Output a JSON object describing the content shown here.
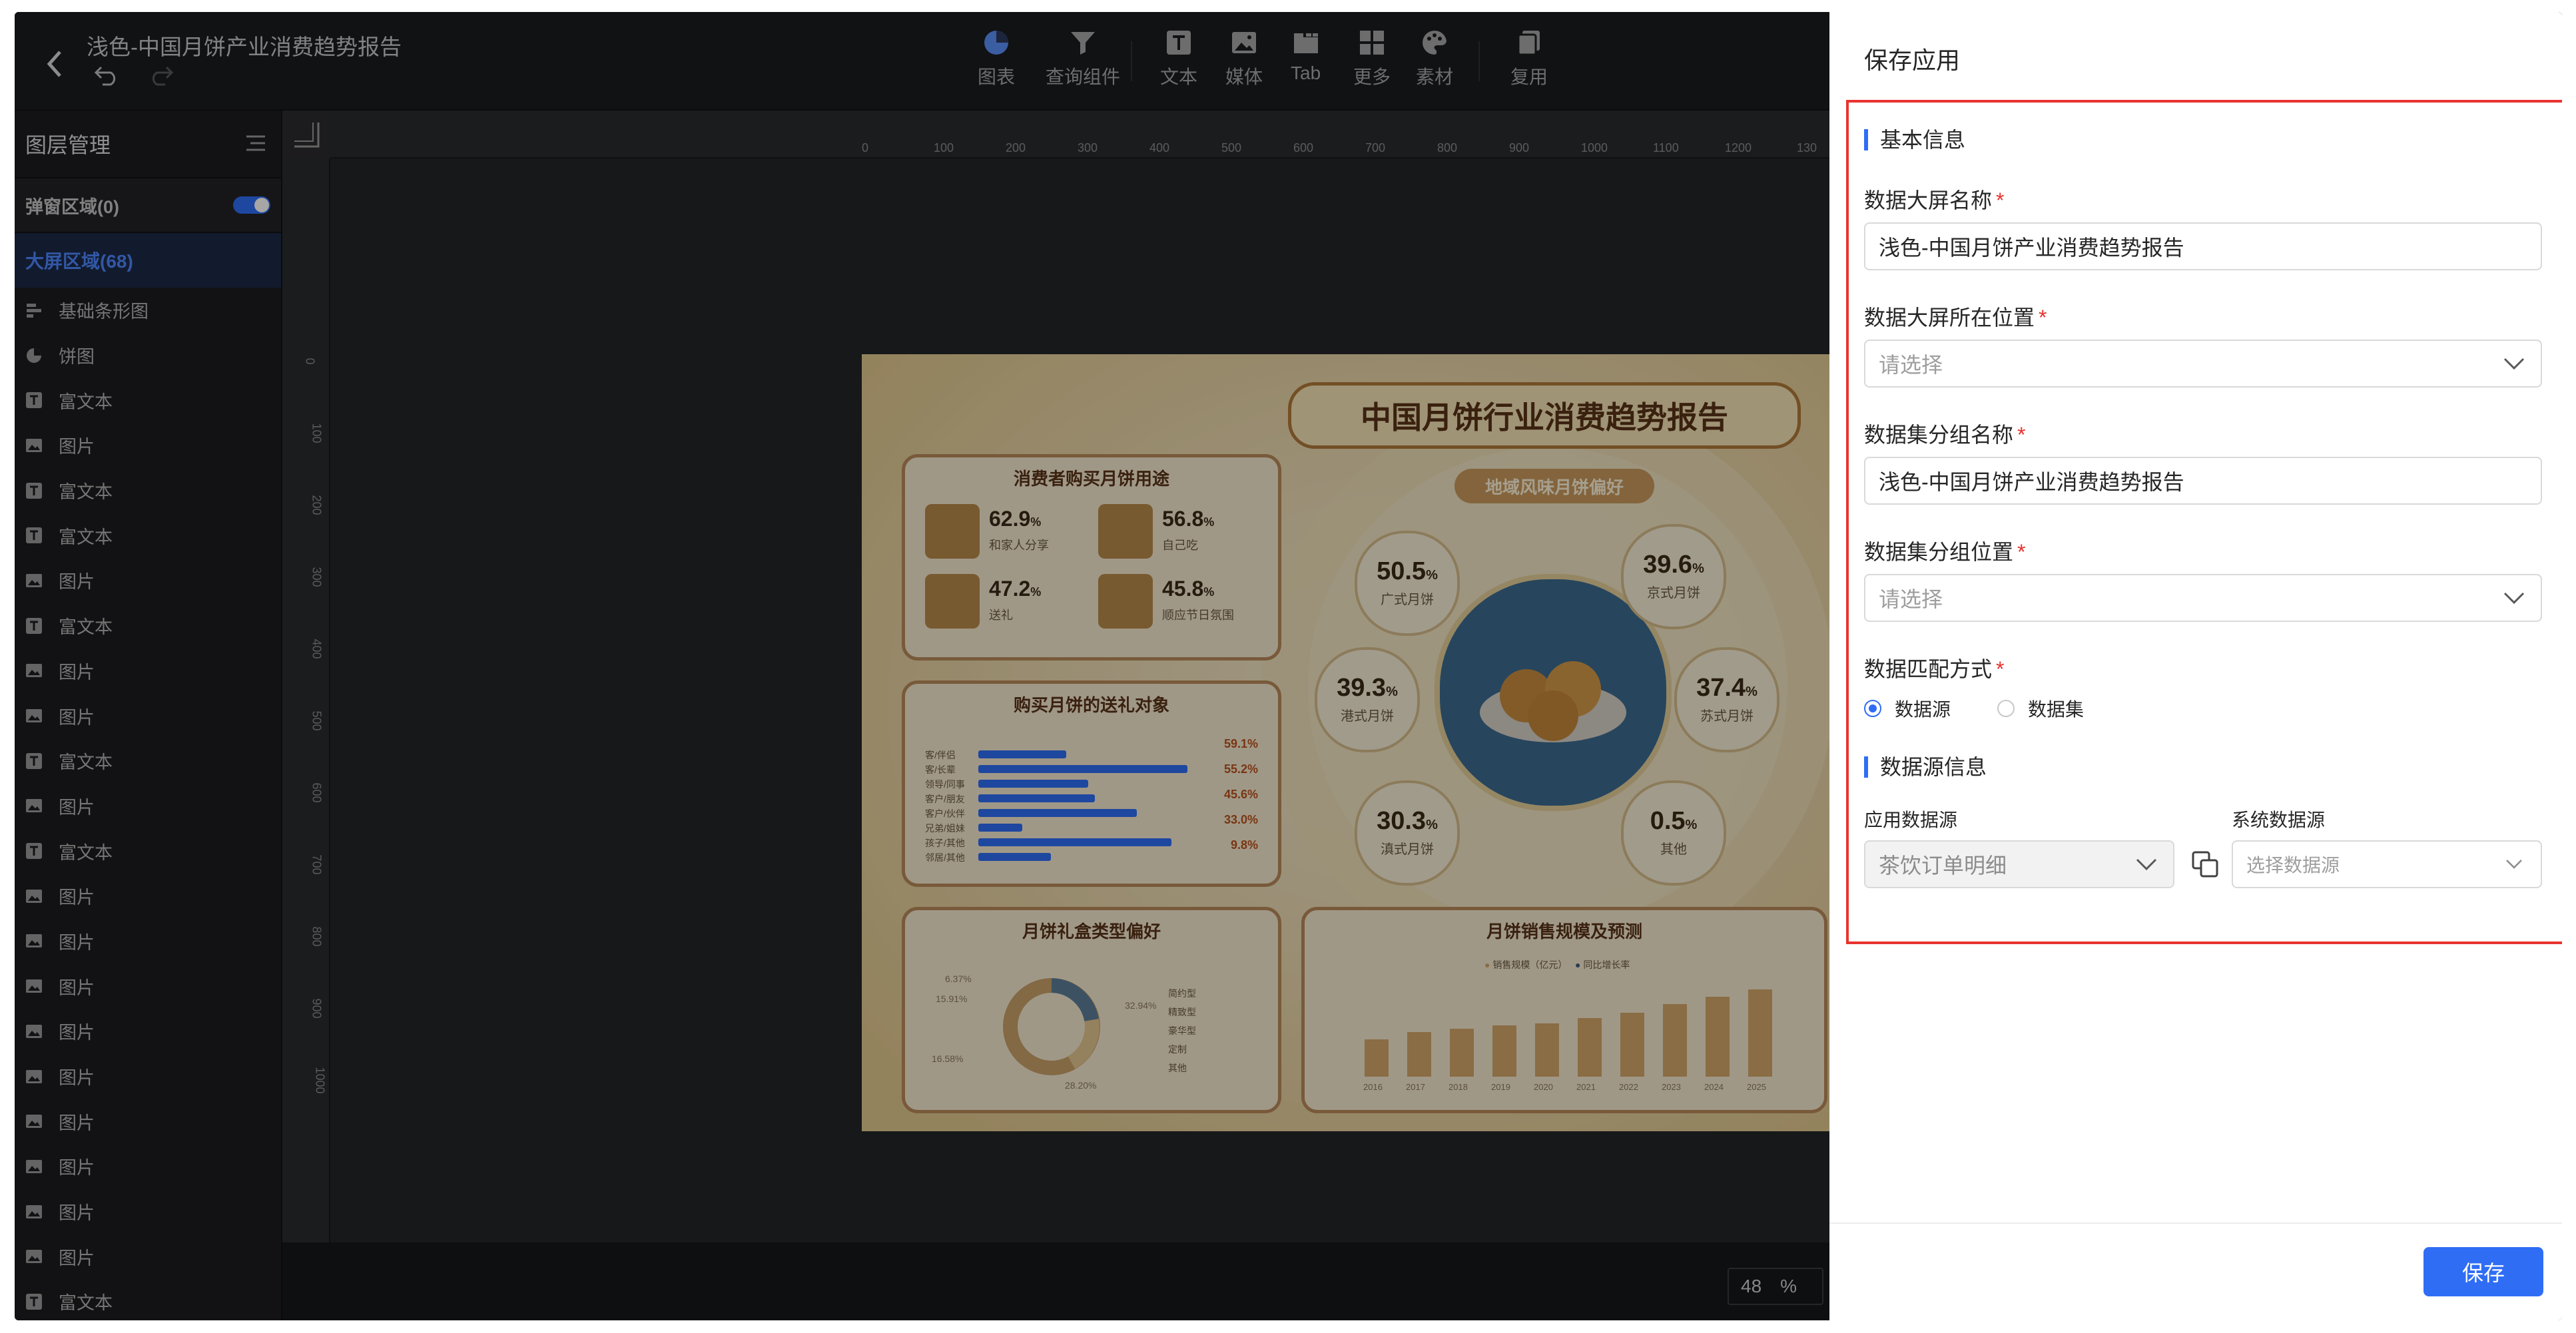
{
  "window": {
    "title": "浅色-中国月饼产业消费趋势报告"
  },
  "toolbar": {
    "items": [
      {
        "label": "图表",
        "icon": "pie-chart-icon",
        "active": true
      },
      {
        "label": "查询组件",
        "icon": "filter-icon"
      },
      {
        "label": "文本",
        "icon": "text-icon"
      },
      {
        "label": "媒体",
        "icon": "image-icon"
      },
      {
        "label": "Tab",
        "icon": "tab-icon"
      },
      {
        "label": "更多",
        "icon": "grid-icon"
      },
      {
        "label": "素材",
        "icon": "palette-icon"
      },
      {
        "label": "复用",
        "icon": "copy-icon"
      }
    ]
  },
  "sidebar": {
    "title": "图层管理",
    "popup_area": "弹窗区域(0)",
    "screen_area": "大屏区域(68)",
    "layers": [
      {
        "label": "基础条形图",
        "type": "bar"
      },
      {
        "label": "饼图",
        "type": "pie"
      },
      {
        "label": "富文本",
        "type": "text"
      },
      {
        "label": "图片",
        "type": "image"
      },
      {
        "label": "富文本",
        "type": "text"
      },
      {
        "label": "富文本",
        "type": "text"
      },
      {
        "label": "图片",
        "type": "image"
      },
      {
        "label": "富文本",
        "type": "text"
      },
      {
        "label": "图片",
        "type": "image"
      },
      {
        "label": "图片",
        "type": "image"
      },
      {
        "label": "富文本",
        "type": "text"
      },
      {
        "label": "图片",
        "type": "image"
      },
      {
        "label": "富文本",
        "type": "text"
      },
      {
        "label": "图片",
        "type": "image"
      },
      {
        "label": "图片",
        "type": "image"
      },
      {
        "label": "图片",
        "type": "image"
      },
      {
        "label": "图片",
        "type": "image"
      },
      {
        "label": "图片",
        "type": "image"
      },
      {
        "label": "图片",
        "type": "image"
      },
      {
        "label": "图片",
        "type": "image"
      },
      {
        "label": "图片",
        "type": "image"
      },
      {
        "label": "图片",
        "type": "image"
      },
      {
        "label": "富文本",
        "type": "text"
      }
    ]
  },
  "canvas": {
    "ruler_top": [
      "0",
      "100",
      "200",
      "300",
      "400",
      "500",
      "600",
      "700",
      "800",
      "900",
      "1000",
      "1100",
      "1200",
      "130"
    ],
    "ruler_left": [
      "0",
      "100",
      "200",
      "300",
      "400",
      "500",
      "600",
      "700",
      "800",
      "900",
      "1000"
    ],
    "zoom": "48",
    "zoom_unit": "%"
  },
  "preview": {
    "title": "中国月饼行业消费趋势报告",
    "card1": {
      "title": "消费者购买月饼用途",
      "stats": [
        {
          "value": "62.9",
          "unit": "%",
          "label": "和家人分享"
        },
        {
          "value": "56.8",
          "unit": "%",
          "label": "自己吃"
        },
        {
          "value": "47.2",
          "unit": "%",
          "label": "送礼"
        },
        {
          "value": "45.8",
          "unit": "%",
          "label": "顺应节日氛围"
        }
      ]
    },
    "card2": {
      "title": "购买月饼的送礼对象",
      "bars": [
        {
          "label": "客/伴侣",
          "value": 0.4
        },
        {
          "label": "客/长辈",
          "value": 0.95
        },
        {
          "label": "领导/同事",
          "value": 0.5
        },
        {
          "label": "客户/朋友",
          "value": 0.53
        },
        {
          "label": "客户/伙伴",
          "value": 0.72
        },
        {
          "label": "兄弟/姐妹",
          "value": 0.2
        },
        {
          "label": "孩子/其他",
          "value": 0.88
        },
        {
          "label": "邻居/其他",
          "value": 0.33
        }
      ],
      "percents": [
        "59.1%",
        "55.2%",
        "45.6%",
        "33.0%",
        "9.8%"
      ]
    },
    "card3": {
      "title": "月饼礼盒类型偏好",
      "labels": [
        "6.37%",
        "15.91%",
        "32.94%",
        "16.58%",
        "28.20%"
      ],
      "legend": [
        "简约型",
        "精致型",
        "豪华型",
        "定制",
        "其他"
      ]
    },
    "region": {
      "tag": "地域风味月饼偏好",
      "bubbles": [
        {
          "value": "50.5",
          "unit": "%",
          "label": "广式月饼"
        },
        {
          "value": "39.6",
          "unit": "%",
          "label": "京式月饼"
        },
        {
          "value": "39.3",
          "unit": "%",
          "label": "港式月饼"
        },
        {
          "value": "37.4",
          "unit": "%",
          "label": "苏式月饼"
        },
        {
          "value": "30.3",
          "unit": "%",
          "label": "滇式月饼"
        },
        {
          "value": "0.5",
          "unit": "%",
          "label": "其他"
        }
      ]
    },
    "card4": {
      "title": "月饼销售规模及预测",
      "legend": [
        "销售规模（亿元）",
        "同比增长率"
      ],
      "years": [
        "2016",
        "2017",
        "2018",
        "2019",
        "2020",
        "2021",
        "2022",
        "2023",
        "2024",
        "2025"
      ],
      "bar_values": [
        0.35,
        0.42,
        0.45,
        0.48,
        0.5,
        0.55,
        0.6,
        0.68,
        0.75,
        0.82
      ]
    }
  },
  "drawer": {
    "title": "保存应用",
    "basic_section": "基本信息",
    "screen_name_label": "数据大屏名称",
    "screen_name_value": "浅色-中国月饼产业消费趋势报告",
    "screen_location_label": "数据大屏所在位置",
    "screen_location_placeholder": "请选择",
    "dataset_group_name_label": "数据集分组名称",
    "dataset_group_name_value": "浅色-中国月饼产业消费趋势报告",
    "dataset_group_location_label": "数据集分组位置",
    "dataset_group_location_placeholder": "请选择",
    "match_mode_label": "数据匹配方式",
    "match_options": [
      "数据源",
      "数据集"
    ],
    "match_selected": "数据源",
    "datasource_section": "数据源信息",
    "app_source_label": "应用数据源",
    "app_source_value": "茶饮订单明细",
    "sys_source_label": "系统数据源",
    "sys_source_placeholder": "选择数据源",
    "save_label": "保存"
  },
  "colors": {
    "accent": "#2f6df5",
    "danger": "#e8332f",
    "sidebar_bg": "#1c1d20"
  }
}
